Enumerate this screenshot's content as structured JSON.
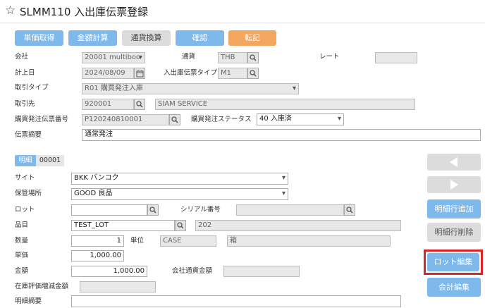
{
  "title": "SLMM110 入出庫伝票登録",
  "toolbar": [
    {
      "label": "単価取得",
      "style": "blue"
    },
    {
      "label": "金額計算",
      "style": "blue"
    },
    {
      "label": "通貨換算",
      "style": "gray"
    },
    {
      "label": "確認",
      "style": "blue"
    },
    {
      "label": "転記",
      "style": "orange"
    }
  ],
  "header": {
    "company": {
      "label": "会社",
      "value": "20001 multiboo"
    },
    "currency": {
      "label": "通貨",
      "value": "THB"
    },
    "rate": {
      "label": "レート",
      "value": ""
    },
    "posting_date": {
      "label": "計上日",
      "value": "2024/08/09"
    },
    "slip_type": {
      "label": "入出庫伝票タイプ",
      "value": "M1"
    },
    "txn_type": {
      "label": "取引タイプ",
      "value": "R01 購買発注入庫"
    },
    "partner": {
      "label": "取引先",
      "code": "920001",
      "name": "SIAM SERVICE"
    },
    "po_number": {
      "label": "購買発注伝票番号",
      "value": "P120240810001"
    },
    "po_status": {
      "label": "購買発注ステータス",
      "value": "40 入庫済"
    },
    "memo": {
      "label": "伝票摘要",
      "value": "通常発注"
    }
  },
  "detail": {
    "tab_label": "明細",
    "line_no": "00001",
    "site": {
      "label": "サイト",
      "value": "BKK バンコク"
    },
    "location": {
      "label": "保管場所",
      "value": "GOOD 良品"
    },
    "lot": {
      "label": "ロット",
      "value": ""
    },
    "serial": {
      "label": "シリアル番号",
      "value": ""
    },
    "item": {
      "label": "品目",
      "code": "TEST_LOT",
      "name": "202"
    },
    "qty": {
      "label": "数量",
      "value": "1"
    },
    "unit": {
      "label": "単位",
      "code": "CASE",
      "name": "箱"
    },
    "price": {
      "label": "単価",
      "value": "1,000.00"
    },
    "amount": {
      "label": "金額",
      "value": "1,000.00"
    },
    "company_amount": {
      "label": "会社通貨金額",
      "value": ""
    },
    "inv_diff": {
      "label": "在庫評価増減金額",
      "value": ""
    },
    "line_memo": {
      "label": "明細摘要",
      "value": ""
    }
  },
  "side": {
    "add_line": "明細行追加",
    "delete_line": "明細行削除",
    "lot_edit": "ロット編集",
    "account_edit": "会計編集"
  },
  "colors": {
    "accent": "#7fb9ec",
    "orange": "#f2a65e",
    "highlight": "#d9252a"
  }
}
